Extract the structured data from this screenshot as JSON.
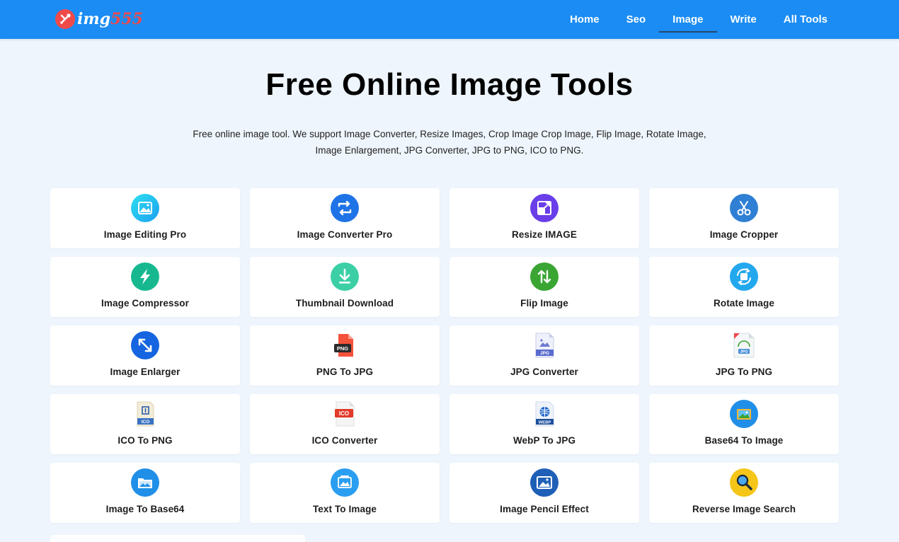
{
  "brand": {
    "logo_part1": "img",
    "logo_part2": "555",
    "logo_icon": "wrench-screwdriver-icon",
    "primary_color": "#1a8cf4",
    "accent_color": "#ef4a4a"
  },
  "nav": {
    "items": [
      {
        "label": "Home"
      },
      {
        "label": "Seo"
      },
      {
        "label": "Image",
        "active": true
      },
      {
        "label": "Write"
      },
      {
        "label": "All Tools"
      }
    ]
  },
  "hero": {
    "title": "Free Online Image Tools",
    "description_line1": "Free online image tool. We support Image Converter, Resize Images, Crop Image Crop Image, Flip Image, Rotate Image,",
    "description_line2": "Image Enlargement, JPG Converter, JPG to PNG, ICO to PNG."
  },
  "tools": [
    {
      "label": "Image Editing Pro",
      "icon": "image-edit-icon"
    },
    {
      "label": "Image Converter Pro",
      "icon": "convert-arrows-icon"
    },
    {
      "label": "Resize IMAGE",
      "icon": "resize-icon"
    },
    {
      "label": "Image Cropper",
      "icon": "scissors-icon"
    },
    {
      "label": "Image Compressor",
      "icon": "lightning-icon"
    },
    {
      "label": "Thumbnail Download",
      "icon": "download-icon"
    },
    {
      "label": "Flip Image",
      "icon": "flip-arrows-icon"
    },
    {
      "label": "Rotate Image",
      "icon": "rotate-icon"
    },
    {
      "label": "Image Enlarger",
      "icon": "enlarge-arrow-icon"
    },
    {
      "label": "PNG To JPG",
      "icon": "png-file-icon",
      "badge": "PNG"
    },
    {
      "label": "JPG Converter",
      "icon": "jpg-file-icon",
      "badge": "JPG"
    },
    {
      "label": "JPG To PNG",
      "icon": "jpg-png-file-icon",
      "badge": "JPG"
    },
    {
      "label": "ICO To PNG",
      "icon": "ico-file-icon",
      "badge": "ICO"
    },
    {
      "label": "ICO Converter",
      "icon": "ico-converter-file-icon",
      "badge": "ICO"
    },
    {
      "label": "WebP To JPG",
      "icon": "webp-file-icon",
      "badge": "WEBP"
    },
    {
      "label": "Base64 To Image",
      "icon": "base64-image-icon"
    },
    {
      "label": "Image To Base64",
      "icon": "folder-image-icon"
    },
    {
      "label": "Text To Image",
      "icon": "text-image-icon"
    },
    {
      "label": "Image Pencil Effect",
      "icon": "pencil-image-icon"
    },
    {
      "label": "Reverse Image Search",
      "icon": "magnifier-icon"
    }
  ]
}
